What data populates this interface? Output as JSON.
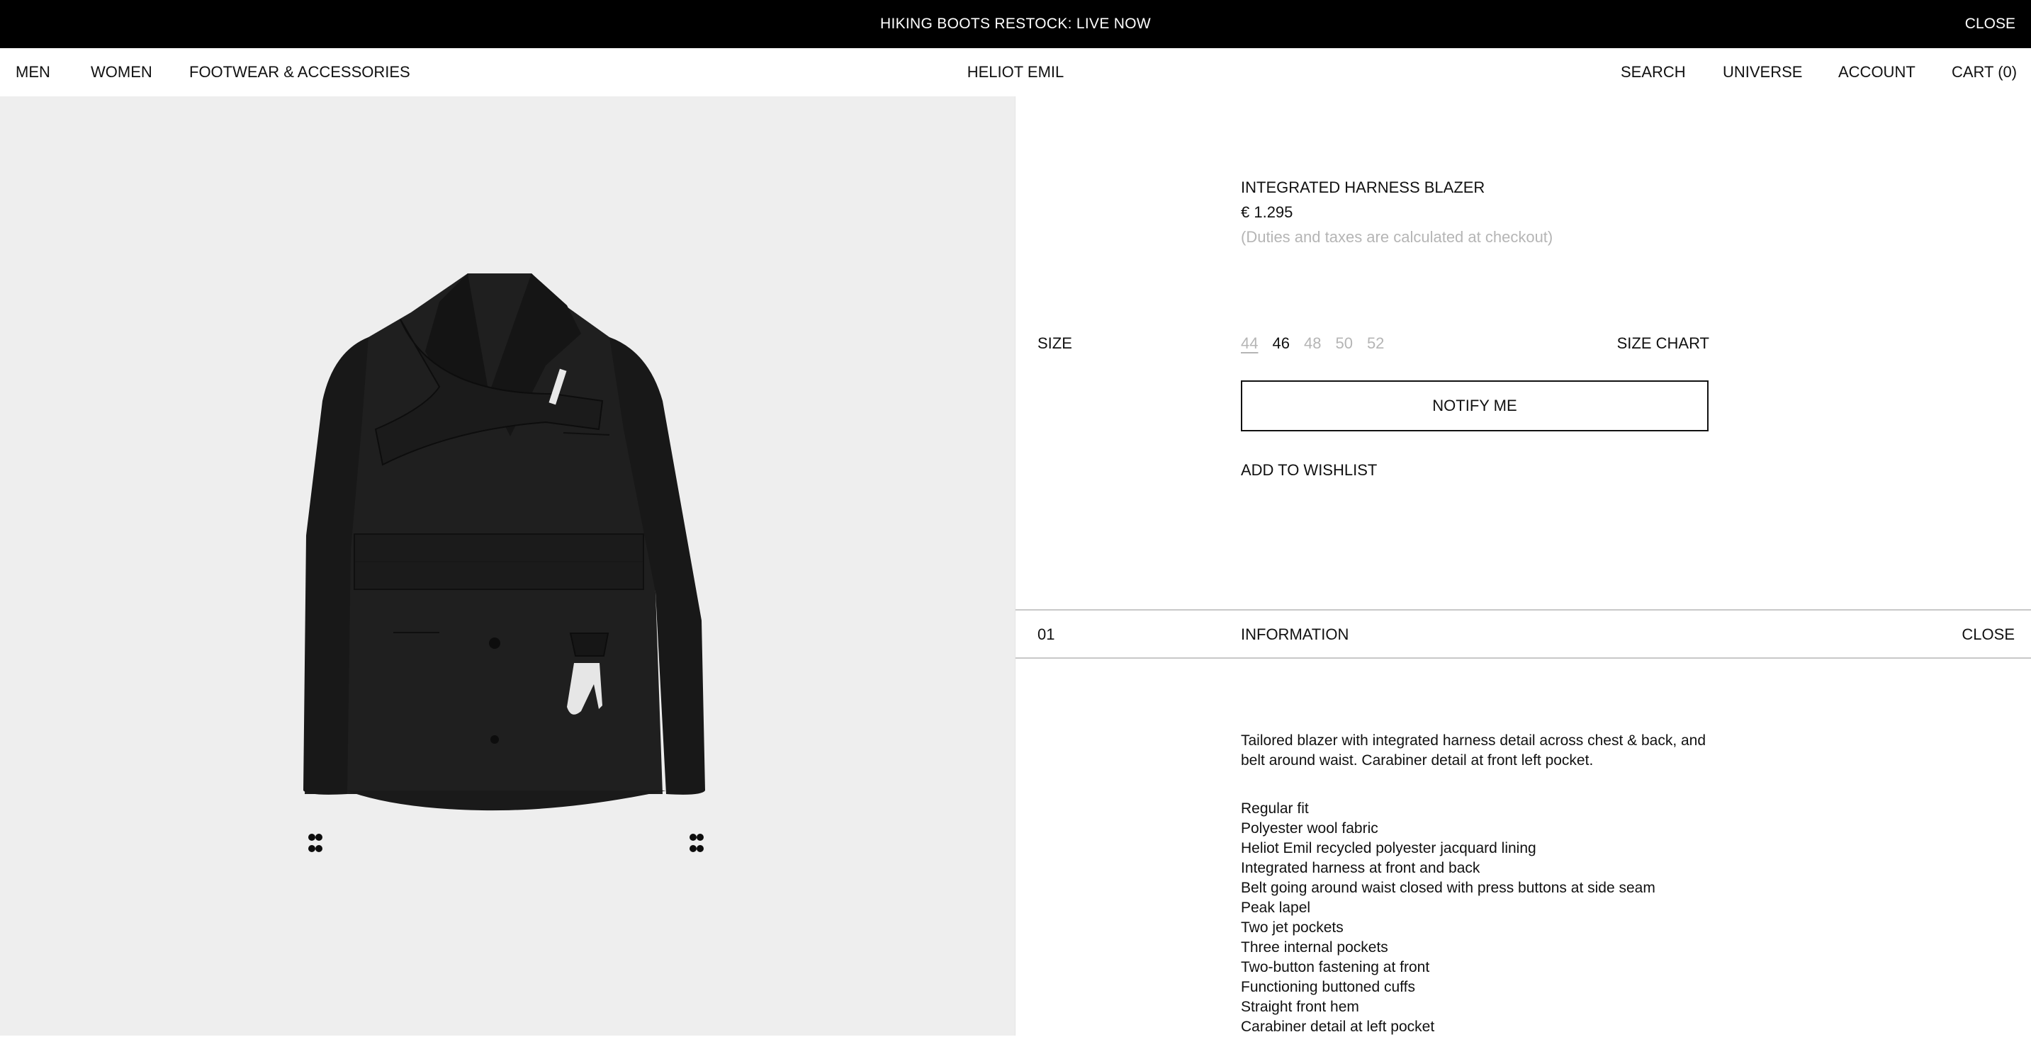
{
  "announcement": {
    "message": "HIKING BOOTS RESTOCK: LIVE NOW",
    "close_label": "CLOSE"
  },
  "nav": {
    "left": [
      "MEN",
      "WOMEN",
      "FOOTWEAR & ACCESSORIES"
    ],
    "brand": "HELIOT EMIL",
    "right": [
      "SEARCH",
      "UNIVERSE",
      "ACCOUNT",
      "CART (0)"
    ]
  },
  "product": {
    "name": "INTEGRATED HARNESS BLAZER",
    "price": "€ 1.295",
    "duties_note": "(Duties and taxes are calculated at checkout)",
    "size_label": "SIZE",
    "sizes": [
      "44",
      "46",
      "48",
      "50",
      "52"
    ],
    "selected_size": "46",
    "size_chart_label": "SIZE CHART",
    "notify_label": "NOTIFY ME",
    "wishlist_label": "ADD TO WISHLIST",
    "image_icon": "blazer-product-image"
  },
  "info": {
    "number": "01",
    "title": "INFORMATION",
    "close_label": "CLOSE",
    "description": "Tailored blazer with integrated harness detail across chest & back, and belt around waist. Carabiner detail at front left pocket.",
    "features": [
      "Regular fit",
      "Polyester wool fabric",
      "Heliot Emil recycled polyester jacquard lining",
      "Integrated harness at front and back",
      "Belt going around waist closed with press buttons at side seam",
      "Peak lapel",
      "Two jet pockets",
      "Three internal pockets",
      "Two-button fastening at front",
      "Functioning buttoned cuffs",
      "Straight front hem",
      "Carabiner detail at left pocket"
    ]
  },
  "colors": {
    "announcement_bg": "#000000",
    "gallery_bg": "#eeeeee",
    "muted_text": "#b5b5b5",
    "blazer": "#1f1f1f"
  }
}
